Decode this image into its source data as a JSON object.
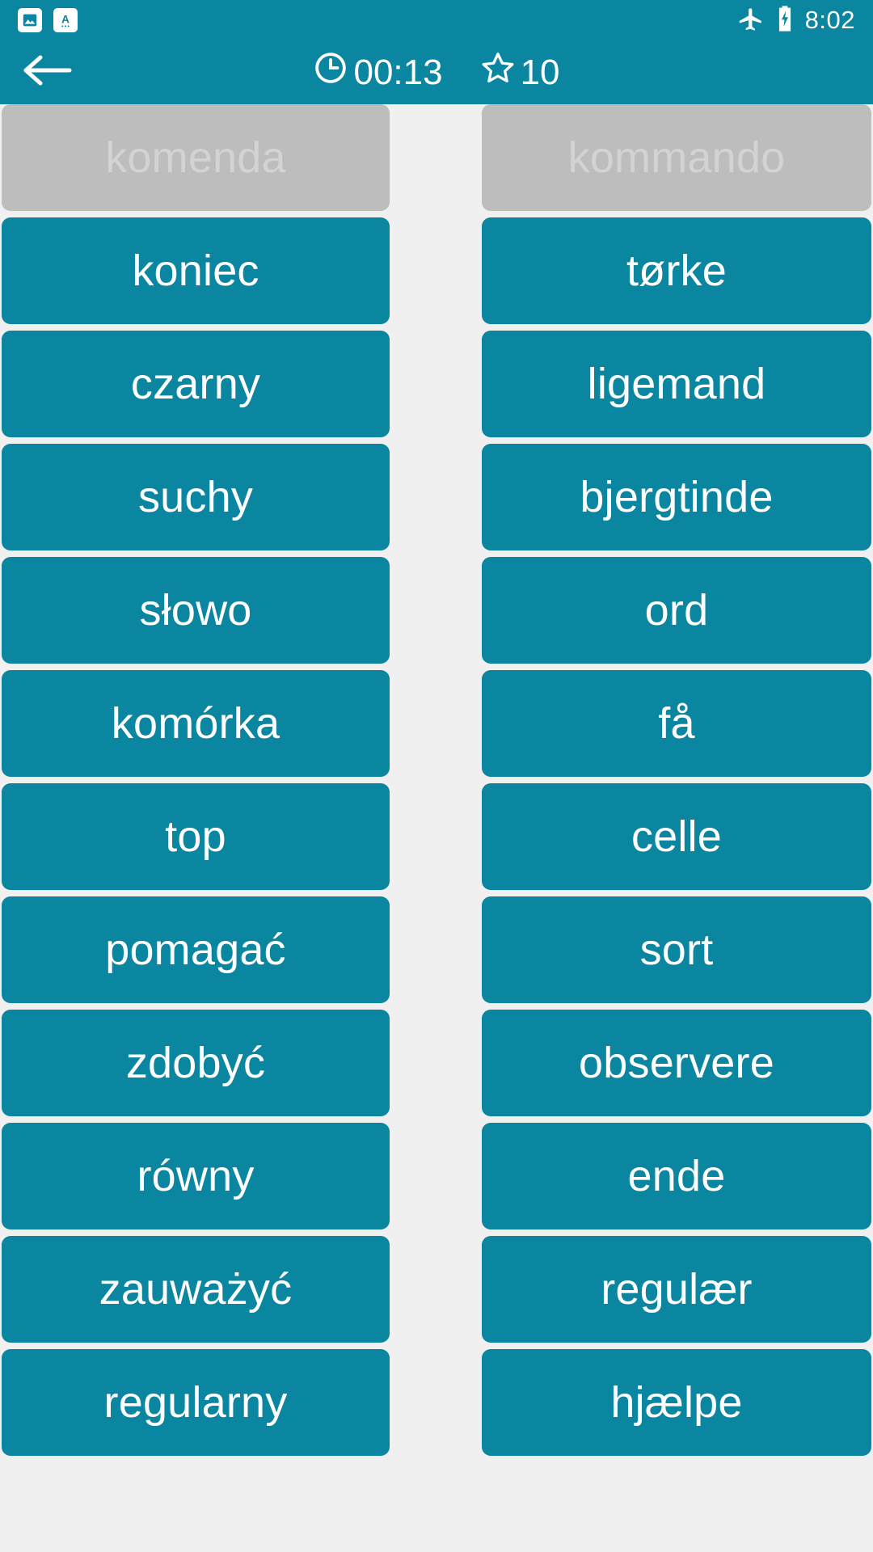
{
  "status_bar": {
    "icons": [
      "image-icon",
      "translate-icon"
    ],
    "right_icons": [
      "airplane-mode-icon",
      "battery-charging-icon"
    ],
    "time": "8:02"
  },
  "action_bar": {
    "back_icon": "back-arrow-icon",
    "timer_icon": "clock-icon",
    "timer": "00:13",
    "score_icon": "star-icon",
    "score": "10"
  },
  "theme": {
    "accent": "#0b86a0",
    "matched": "#bdbdbd",
    "matched_text": "#d3d3d3",
    "board_bg": "#f0f0f0",
    "card_text": "#ffffff"
  },
  "board": {
    "left_column": [
      {
        "label": "komenda",
        "state": "matched"
      },
      {
        "label": "koniec",
        "state": "active"
      },
      {
        "label": "czarny",
        "state": "active"
      },
      {
        "label": "suchy",
        "state": "active"
      },
      {
        "label": "słowo",
        "state": "active"
      },
      {
        "label": "komórka",
        "state": "active"
      },
      {
        "label": "top",
        "state": "active"
      },
      {
        "label": "pomagać",
        "state": "active"
      },
      {
        "label": "zdobyć",
        "state": "active"
      },
      {
        "label": "równy",
        "state": "active"
      },
      {
        "label": "zauważyć",
        "state": "active"
      },
      {
        "label": "regularny",
        "state": "active"
      }
    ],
    "right_column": [
      {
        "label": "kommando",
        "state": "matched"
      },
      {
        "label": "tørke",
        "state": "active"
      },
      {
        "label": "ligemand",
        "state": "active"
      },
      {
        "label": "bjergtinde",
        "state": "active"
      },
      {
        "label": "ord",
        "state": "active"
      },
      {
        "label": "få",
        "state": "active"
      },
      {
        "label": "celle",
        "state": "active"
      },
      {
        "label": "sort",
        "state": "active"
      },
      {
        "label": "observere",
        "state": "active"
      },
      {
        "label": "ende",
        "state": "active"
      },
      {
        "label": "regulær",
        "state": "active"
      },
      {
        "label": "hjælpe",
        "state": "active"
      }
    ]
  }
}
